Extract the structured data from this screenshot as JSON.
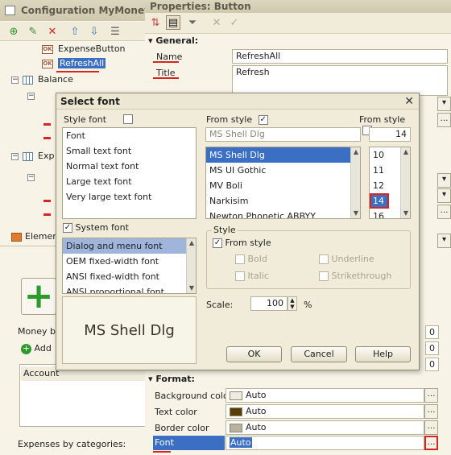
{
  "left_window": {
    "title": "Configuration MyMoney: D",
    "tree": {
      "expense_button": "ExpenseButton",
      "refresh_all": "RefreshAll",
      "balance": "Balance",
      "exp": "Exp",
      "elements": "Elemen"
    },
    "money_label": "Money ba",
    "add_label": "Add",
    "account_header": "Account",
    "expenses_label": "Expenses by categories:"
  },
  "properties": {
    "title": "Properties: Button",
    "general_section": "General:",
    "name_label": "Name",
    "name_value": "RefreshAll",
    "title_label": "Title",
    "title_value": "Refresh",
    "format_section": "Format:",
    "rows": [
      {
        "label": "Background color",
        "value": "Auto",
        "swatch": "#efebe0"
      },
      {
        "label": "Text color",
        "value": "Auto",
        "swatch": "#5a3e08"
      },
      {
        "label": "Border color",
        "value": "Auto",
        "swatch": "#b7b1a0"
      },
      {
        "label": "Font",
        "value": "Auto"
      }
    ],
    "spin_values": [
      "0",
      "0",
      "0"
    ]
  },
  "dialog": {
    "title": "Select font",
    "style_font_label": "Style font",
    "style_font_items": [
      "Font",
      "Small text font",
      "Normal text font",
      "Large text font",
      "Very large text font"
    ],
    "system_font_label": "System font",
    "system_font_items": [
      "Dialog and menu font",
      "OEM fixed-width font",
      "ANSI fixed-width font",
      "ANSI proportional font"
    ],
    "from_style_label": "From style",
    "from_style_label2": "From style",
    "font_input_value": "MS Shell Dlg",
    "size_input_value": "14",
    "font_items": [
      "MS Shell Dlg",
      "MS UI Gothic",
      "MV Boli",
      "Narkisim",
      "Newton Phonetic ABBYY"
    ],
    "size_items": [
      "10",
      "11",
      "12",
      "14",
      "16"
    ],
    "style_group_label": "Style",
    "style_from_style": "From style",
    "bold": "Bold",
    "italic": "Italic",
    "underline": "Underline",
    "strikethrough": "Strikethrough",
    "scale_label": "Scale:",
    "scale_value": "100",
    "scale_unit": "%",
    "preview_text": "MS Shell Dlg",
    "ok": "OK",
    "cancel": "Cancel",
    "help": "Help"
  },
  "colors": {
    "selection": "#3a6fc4",
    "highlight_red": "#d7261e",
    "plus_green": "#2d9a2d"
  }
}
